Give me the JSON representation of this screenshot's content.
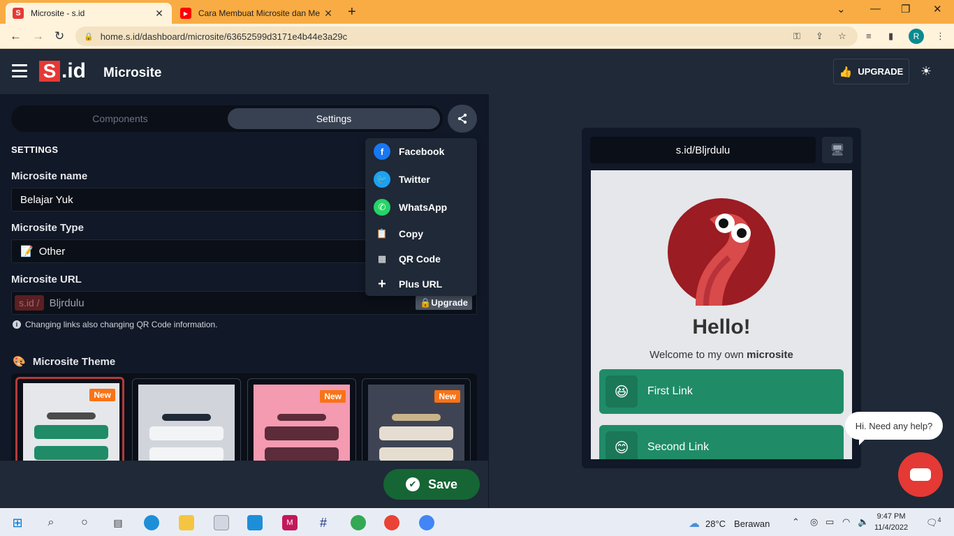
{
  "browser": {
    "tabs": [
      {
        "favicon": "S",
        "title": "Microsite - s.id"
      },
      {
        "favicon": "▶",
        "title": "Cara Membuat Microsite dan Me"
      }
    ],
    "url": "home.s.id/dashboard/microsite/63652599d3171e4b44e3a29c",
    "profile_initial": "R",
    "accent_color": "#f9ac43"
  },
  "header": {
    "logo_s": "S",
    "logo_id": ".id",
    "title": "Microsite",
    "upgrade_label": "UPGRADE"
  },
  "segment": {
    "components_label": "Components",
    "settings_label": "Settings"
  },
  "settings": {
    "section_title": "SETTINGS",
    "name_label": "Microsite name",
    "name_value": "Belajar Yuk",
    "type_label": "Microsite Type",
    "type_emoji": "📝",
    "type_value": "Other",
    "url_label": "Microsite URL",
    "url_prefix": "s.id /",
    "url_value": "Bljrdulu",
    "url_upgrade": "Upgrade",
    "info_text": "Changing links also changing QR Code information.",
    "theme_emoji": "🎨",
    "theme_title": "Microsite Theme",
    "new_badge": "New"
  },
  "share_menu": {
    "items": [
      {
        "label": "Facebook",
        "icon": "facebook-icon"
      },
      {
        "label": "Twitter",
        "icon": "twitter-icon"
      },
      {
        "label": "WhatsApp",
        "icon": "whatsapp-icon"
      },
      {
        "label": "Copy",
        "icon": "copy-icon"
      },
      {
        "label": "QR Code",
        "icon": "qr-code-icon"
      },
      {
        "label": "Plus URL",
        "icon": "plus-icon"
      }
    ]
  },
  "save_label": "Save",
  "preview": {
    "url": "s.id/Bljrdulu",
    "hello": "Hello!",
    "welcome_prefix": "Welcome to my own ",
    "welcome_bold": "microsite",
    "links": [
      {
        "emoji": "😆",
        "label": "First Link"
      },
      {
        "emoji": "😊",
        "label": "Second Link"
      }
    ]
  },
  "help_text": "Hi. Need any help?",
  "taskbar": {
    "temperature": "28°C",
    "weather": "Berawan",
    "time": "9:47 PM",
    "date": "11/4/2022",
    "notifications": "4"
  }
}
